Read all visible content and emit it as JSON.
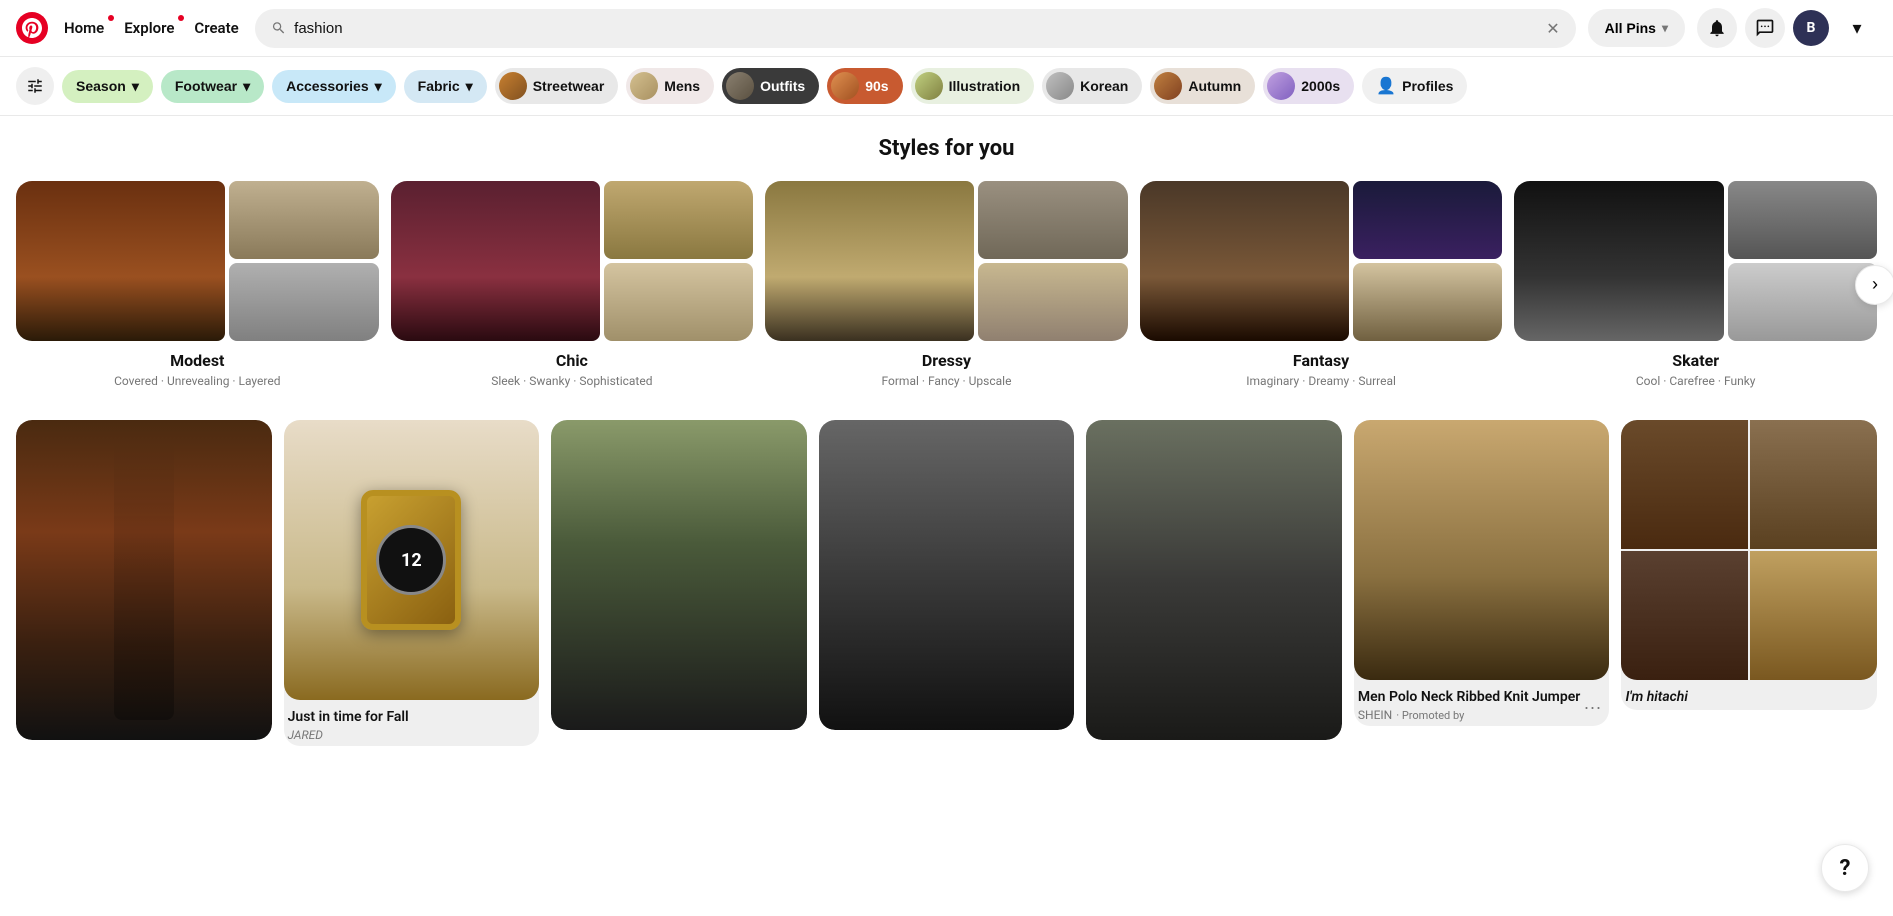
{
  "header": {
    "logo_char": "P",
    "nav": [
      {
        "label": "Home",
        "has_dot": true
      },
      {
        "label": "Explore",
        "has_dot": true
      },
      {
        "label": "Create",
        "has_dot": false
      }
    ],
    "search_value": "fashion",
    "search_placeholder": "Search",
    "all_pins_label": "All Pins",
    "notifications_icon": "🔔",
    "messages_icon": "💬",
    "avatar_char": "B",
    "chevron": "▾"
  },
  "filters": [
    {
      "label": "Season",
      "has_arrow": true,
      "bg": "#d4f0c0",
      "text_color": "#111",
      "img": null
    },
    {
      "label": "Footwear",
      "has_arrow": true,
      "bg": "#b8e8c8",
      "text_color": "#111",
      "img": null
    },
    {
      "label": "Accessories",
      "has_arrow": true,
      "bg": "#c8e8f8",
      "text_color": "#111",
      "img": null
    },
    {
      "label": "Fabric",
      "has_arrow": true,
      "bg": "#d4e8f4",
      "text_color": "#111",
      "img": null
    },
    {
      "label": "Streetwear",
      "has_arrow": false,
      "bg": "#e8e8e8",
      "text_color": "#111",
      "img": "streetwear"
    },
    {
      "label": "Mens",
      "has_arrow": false,
      "bg": "#f0e8e8",
      "text_color": "#111",
      "img": "mens"
    },
    {
      "label": "Outfits",
      "has_arrow": false,
      "bg": "#3a3a3a",
      "text_color": "#fff",
      "img": "outfits"
    },
    {
      "label": "90s",
      "has_arrow": false,
      "bg": "#c85a30",
      "text_color": "#fff",
      "img": "90s"
    },
    {
      "label": "Illustration",
      "has_arrow": false,
      "bg": "#e8f0e0",
      "text_color": "#111",
      "img": "illustration"
    },
    {
      "label": "Korean",
      "has_arrow": false,
      "bg": "#e8e8e8",
      "text_color": "#111",
      "img": "korean"
    },
    {
      "label": "Autumn",
      "has_arrow": false,
      "bg": "#e8e0d8",
      "text_color": "#111",
      "img": "autumn"
    },
    {
      "label": "2000s",
      "has_arrow": false,
      "bg": "#e8e0f0",
      "text_color": "#111",
      "img": "2000s"
    },
    {
      "label": "Profiles",
      "has_arrow": false,
      "bg": "#f0f0f0",
      "text_color": "#111",
      "img": "profiles",
      "icon": "👤"
    }
  ],
  "section_title": "Styles for you",
  "styles": [
    {
      "name": "Modest",
      "tags": "Covered · Unrevealing · Layered",
      "colors": [
        "#7a4a2e",
        "#c4b090",
        "#b8b8b8"
      ]
    },
    {
      "name": "Chic",
      "tags": "Sleek · Swanky · Sophisticated",
      "colors": [
        "#6b2737",
        "#c0a880",
        "#d4c4a0"
      ]
    },
    {
      "name": "Dressy",
      "tags": "Formal · Fancy · Upscale",
      "colors": [
        "#b0a070",
        "#9a9080",
        "#c8b890"
      ]
    },
    {
      "name": "Fantasy",
      "tags": "Imaginary · Dreamy · Surreal",
      "colors": [
        "#8a7060",
        "#1a1a3a",
        "#d4c4a0"
      ]
    },
    {
      "name": "Skater",
      "tags": "Cool · Carefree · Funky",
      "colors": [
        "#111",
        "#888",
        "#ccc"
      ]
    }
  ],
  "pins": [
    {
      "id": "brown-coat",
      "title": "",
      "subtitle": "",
      "bg": "pin-brown-coat",
      "has_info": false
    },
    {
      "id": "watch",
      "title": "Just in time for Fall",
      "subtitle": "",
      "bg": "pin-watch",
      "has_info": true
    },
    {
      "id": "green-jacket",
      "title": "",
      "subtitle": "",
      "bg": "pin-green-jacket",
      "has_info": false
    },
    {
      "id": "dark-outfit",
      "title": "",
      "subtitle": "",
      "bg": "pin-dark-outfit",
      "has_info": false
    },
    {
      "id": "black-coat",
      "title": "",
      "subtitle": "",
      "bg": "pin-black-coat",
      "has_info": false
    },
    {
      "id": "knit-jumper",
      "title": "Men Polo Neck Ribbed Knit Jumper",
      "subtitle": "SHEIN",
      "promoted": true,
      "bg": "pin-knit",
      "has_info": true
    },
    {
      "id": "collage",
      "title": "I'm hitachi",
      "subtitle": "",
      "bg": "pin-collage",
      "has_info": true
    }
  ],
  "help": "?"
}
